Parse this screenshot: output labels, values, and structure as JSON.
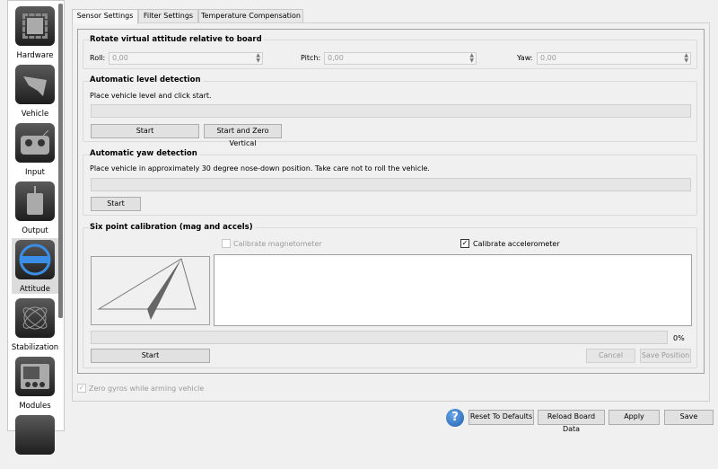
{
  "sidebar": {
    "items": [
      {
        "label": "Hardware",
        "icon": "chip-icon"
      },
      {
        "label": "Vehicle",
        "icon": "aircraft-icon"
      },
      {
        "label": "Input",
        "icon": "transmitter-icon"
      },
      {
        "label": "Output",
        "icon": "motor-icon"
      },
      {
        "label": "Attitude",
        "icon": "level-icon",
        "selected": true
      },
      {
        "label": "Stabilization",
        "icon": "gyro-icon"
      },
      {
        "label": "Modules",
        "icon": "modules-icon"
      }
    ]
  },
  "tabs": [
    "Sensor Settings",
    "Filter Settings",
    "Temperature Compensation"
  ],
  "rotate": {
    "title": "Rotate virtual attitude relative to board",
    "roll_label": "Roll:",
    "roll": "0,00",
    "pitch_label": "Pitch:",
    "pitch": "0,00",
    "yaw_label": "Yaw:",
    "yaw": "0,00"
  },
  "level": {
    "title": "Automatic level detection",
    "text": "Place vehicle level and click start.",
    "start": "Start",
    "start_zero": "Start and Zero Vertical"
  },
  "yawdet": {
    "title": "Automatic yaw detection",
    "text": "Place vehicle in approximately 30 degree nose-down position. Take care not to roll the vehicle.",
    "start": "Start"
  },
  "six": {
    "title": "Six point calibration (mag and accels)",
    "mag_label": "Calibrate magnetometer",
    "mag_checked": false,
    "accel_label": "Calibrate accelerometer",
    "accel_checked": true,
    "progress": "0%",
    "start": "Start",
    "cancel": "Cancel",
    "save_position": "Save Position"
  },
  "zero_gyros": "Zero gyros while arming vehicle",
  "footer": {
    "reset": "Reset To Defaults",
    "reload": "Reload Board Data",
    "apply": "Apply",
    "save": "Save"
  }
}
